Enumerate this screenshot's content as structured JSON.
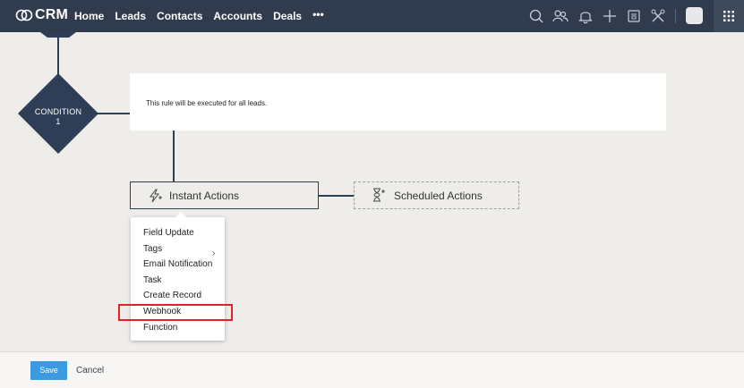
{
  "app": {
    "logo_text": "CRM"
  },
  "nav": {
    "items": [
      "Home",
      "Leads",
      "Contacts",
      "Accounts",
      "Deals"
    ],
    "more": "•••"
  },
  "toolbar_icons": [
    "search-icon",
    "contacts-icon",
    "bell-icon",
    "plus-icon",
    "calendar-icon",
    "tools-icon",
    "avatar",
    "apps-grid-icon"
  ],
  "flow": {
    "condition_label": "CONDITION",
    "condition_number": "1",
    "rule_text": "This rule will be executed for all leads.",
    "instant_actions": "Instant Actions",
    "scheduled_actions": "Scheduled Actions"
  },
  "menu": {
    "items": [
      "Field Update",
      "Tags",
      "Email Notification",
      "Task",
      "Create Record",
      "Webhook",
      "Function"
    ],
    "highlighted": "Webhook"
  },
  "footer": {
    "save": "Save",
    "cancel": "Cancel"
  },
  "colors": {
    "topbar": "#303b4e",
    "node": "#2d3e56",
    "save": "#3c9ae0",
    "highlight": "#e0232b"
  }
}
